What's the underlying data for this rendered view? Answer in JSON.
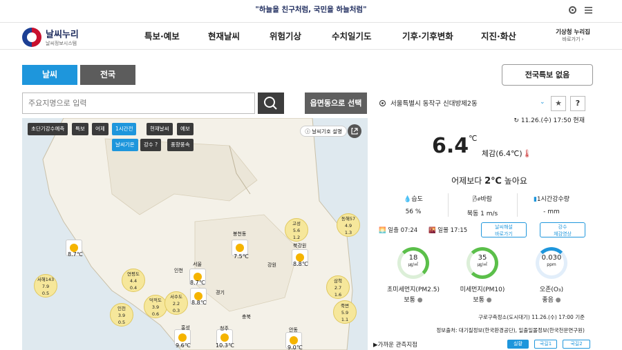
{
  "top_banner": "\"하늘을 친구처럼, 국민을 하늘처럼\"",
  "header": {
    "logo_title": "날씨누리",
    "logo_subtitle": "날씨정보시스템",
    "menu": [
      "특보·예보",
      "현재날씨",
      "위험기상",
      "수치일기도",
      "기후·기후변화",
      "지진·화산"
    ],
    "kma_title": "기상청 누리집",
    "kma_sub": "바로가기 ›"
  },
  "tabs": [
    "날씨",
    "전국"
  ],
  "warning_button": "전국특보 없음",
  "search": {
    "placeholder": "주요지명으로 입력",
    "region_button": "읍면동으로 선택"
  },
  "map": {
    "buttons_row1": [
      "초단기강수예측",
      "특보",
      "어제",
      "1시간전",
      "현재날씨",
      "예보"
    ],
    "buttons_row2": [
      "날씨기온",
      "강수 ?",
      "풍향풍속"
    ],
    "legend_label": "날씨기호 설명",
    "stations": [
      {
        "label": "8.7℃"
      },
      {
        "label": "7.5℃"
      },
      {
        "label": "8.8℃"
      },
      {
        "label": "8.7℃"
      },
      {
        "label": "8.8℃"
      },
      {
        "label": "9.6℃"
      },
      {
        "label": "10.3℃"
      },
      {
        "label": "9.0℃"
      }
    ],
    "regions": [
      {
        "name": "고성",
        "v1": "5.6",
        "v2": "1.2"
      },
      {
        "name": "동해57",
        "v1": "4.9",
        "v2": "1.3"
      },
      {
        "name": "서해143",
        "v1": "7.9",
        "v2": "0.5"
      },
      {
        "name": "연평도",
        "v1": "4.4",
        "v2": "0.4"
      },
      {
        "name": "덕적도",
        "v1": "3.9",
        "v2": "0.6"
      },
      {
        "name": "서수도",
        "v1": "2.2",
        "v2": "0.3"
      },
      {
        "name": "인천",
        "v1": "3.9",
        "v2": "0.5"
      },
      {
        "name": "삼척",
        "v1": "2.7",
        "v2": "1.6"
      },
      {
        "name": "죽변",
        "v1": "5.9",
        "v2": "1.1"
      }
    ],
    "place_labels": [
      "서울",
      "인천",
      "경기",
      "충북",
      "강원",
      "홍성",
      "청주",
      "안동",
      "봉천동",
      "북강원"
    ]
  },
  "current": {
    "location": "서울특별시 동작구 신대방제2동",
    "obs_time": "11.26.(수) 17:50 현재",
    "temperature": "6.4",
    "temp_unit": "℃",
    "feels_like": "체감(6.4℃)",
    "compare_pre": "어제보다",
    "compare_value": "2℃",
    "compare_post": "높아요",
    "humidity_label": "습도",
    "humidity_value": "56 %",
    "wind_label": "바람",
    "wind_value": "북동 1 m/s",
    "rain_label": "1시간강수량",
    "rain_value": "- mm",
    "sunrise_label": "일출",
    "sunrise": "07:24",
    "sunset_label": "일몰",
    "sunset": "17:15",
    "pill1_line1": "날씨해설",
    "pill1_line2": "바로가기",
    "pill2_line1": "강수",
    "pill2_line2": "체감영상",
    "pm25_value": "18",
    "pm25_unit": "㎍/㎥",
    "pm25_label": "초미세먼지(PM2.5)",
    "pm25_grade": "보통",
    "pm10_value": "35",
    "pm10_unit": "㎍/㎥",
    "pm10_label": "미세먼지(PM10)",
    "pm10_grade": "보통",
    "o3_value": "0.030",
    "o3_unit": "ppm",
    "o3_label": "오존(O₃)",
    "o3_grade": "좋음",
    "station_info": "구로구측정소(도시대기) 11.26.(수) 17:00 기준",
    "source_info": "정보출처: 대기질정보(한국환경공단), 일출일몰정보(한국천문연구원)",
    "near_label": "▶가까운 관측지점",
    "bottom_buttons": [
      "실황",
      "국길1",
      "국길2"
    ]
  },
  "colors": {
    "accent": "#1e96dc",
    "dark_button": "#3d3d3d",
    "sun": "#f5b400"
  }
}
